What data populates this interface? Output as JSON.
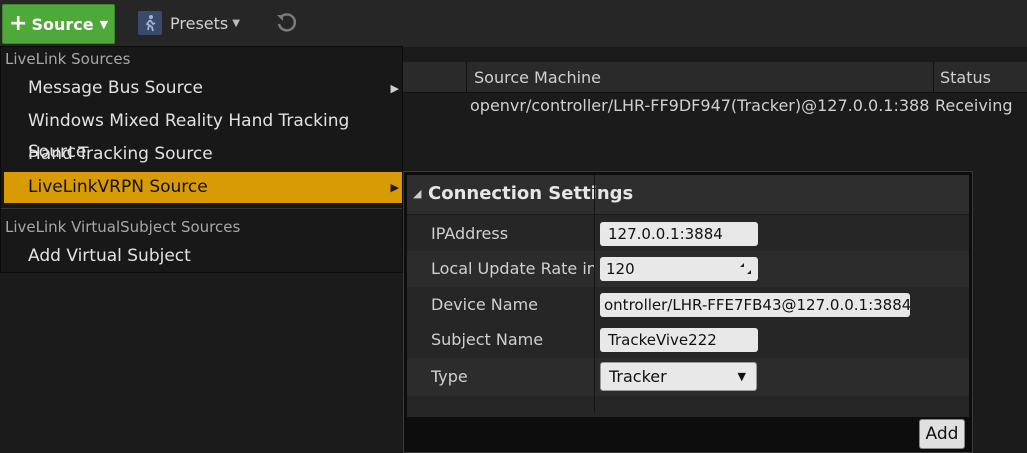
{
  "toolbar": {
    "source_label": "Source",
    "presets_label": "Presets",
    "source_icon": "plus-icon",
    "presets_icon": "runner-icon",
    "undo_icon": "undo-icon"
  },
  "sources_list": {
    "columns": [
      "Source Machine",
      "Status"
    ],
    "rows": [
      {
        "machine": "openvr/controller/LHR-FF9DF947(Tracker)@127.0.0.1:388",
        "status": "Receiving"
      }
    ]
  },
  "source_menu": {
    "sections": [
      {
        "title": "LiveLink Sources",
        "items": [
          {
            "label": "Message Bus Source",
            "has_submenu": true
          },
          {
            "label": "Windows Mixed Reality Hand Tracking Source",
            "has_submenu": false
          },
          {
            "label": "Hand Tracking Source",
            "has_submenu": false
          },
          {
            "label": "LiveLinkVRPN Source",
            "has_submenu": true,
            "highlighted": true
          }
        ]
      },
      {
        "title": "LiveLink VirtualSubject Sources",
        "items": [
          {
            "label": "Add Virtual Subject",
            "has_submenu": false
          }
        ]
      }
    ]
  },
  "connection_settings": {
    "title": "Connection Settings",
    "fields": [
      {
        "label": "IPAddress",
        "value": "127.0.0.1:3884"
      },
      {
        "label": "Local Update Rate in H",
        "value": "120"
      },
      {
        "label": "Device Name",
        "value": "ontroller/LHR-FFE7FB43@127.0.0.1:3884"
      },
      {
        "label": "Subject Name",
        "value": "TrackeVive222"
      },
      {
        "label": "Type",
        "value": "Tracker"
      }
    ],
    "add_button": "Add"
  },
  "colors": {
    "accent_green": "#4fa83a",
    "menu_highlight": "#d99b05",
    "background": "#1b1b1b"
  }
}
